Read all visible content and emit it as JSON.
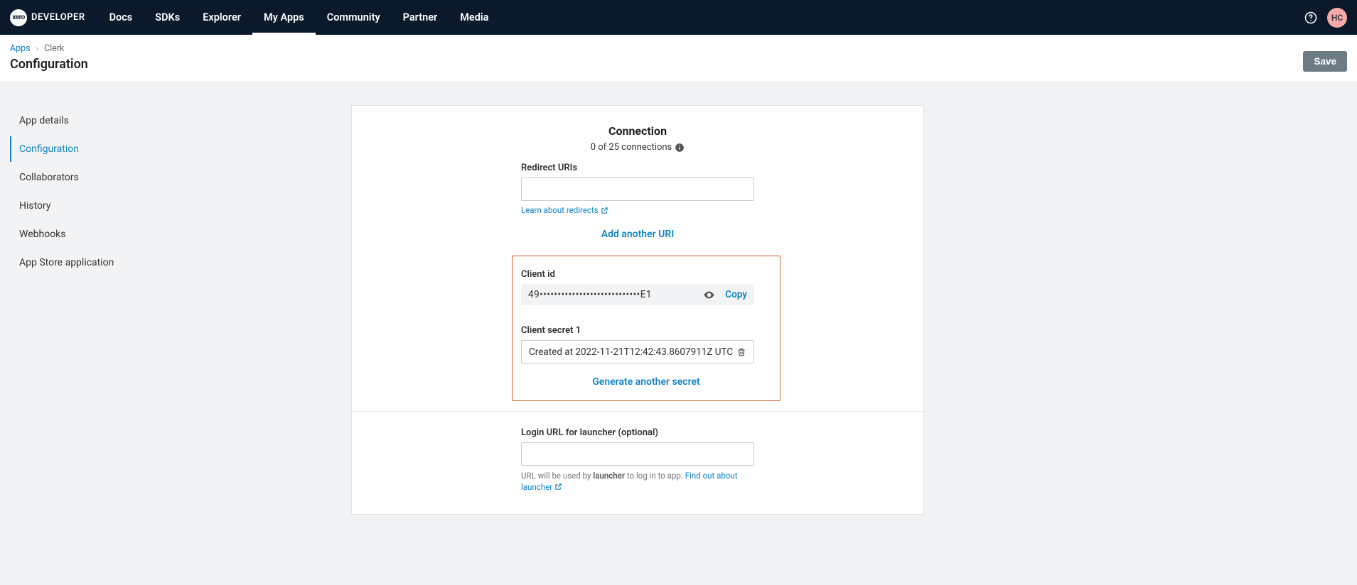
{
  "topnav": {
    "logo_inner": "xero",
    "brand": "DEVELOPER",
    "items": [
      "Docs",
      "SDKs",
      "Explorer",
      "My Apps",
      "Community",
      "Partner",
      "Media"
    ],
    "active_index": 3,
    "avatar": "HC"
  },
  "breadcrumbs": {
    "root": "Apps",
    "current": "Clerk"
  },
  "page_title": "Configuration",
  "save_label": "Save",
  "sidenav": {
    "items": [
      "App details",
      "Configuration",
      "Collaborators",
      "History",
      "Webhooks",
      "App Store application"
    ],
    "active_index": 1
  },
  "connection": {
    "title": "Connection",
    "count_text": "0 of 25 connections",
    "redirect_label": "Redirect URIs",
    "redirect_value": "",
    "learn_link": "Learn about redirects",
    "add_uri": "Add another URI",
    "client_id_label": "Client id",
    "client_id_value": "49••••••••••••••••••••••••••••E1",
    "copy_label": "Copy",
    "client_secret_label": "Client secret 1",
    "client_secret_value": "Created at 2022-11-21T12:42:43.8607911Z UTC",
    "generate_secret": "Generate another secret"
  },
  "login": {
    "label": "Login URL for launcher (optional)",
    "value": "",
    "hint_prefix": "URL will be used by ",
    "hint_strong": "launcher",
    "hint_suffix": " to log in to app. ",
    "hint_link": "Find out about launcher"
  }
}
